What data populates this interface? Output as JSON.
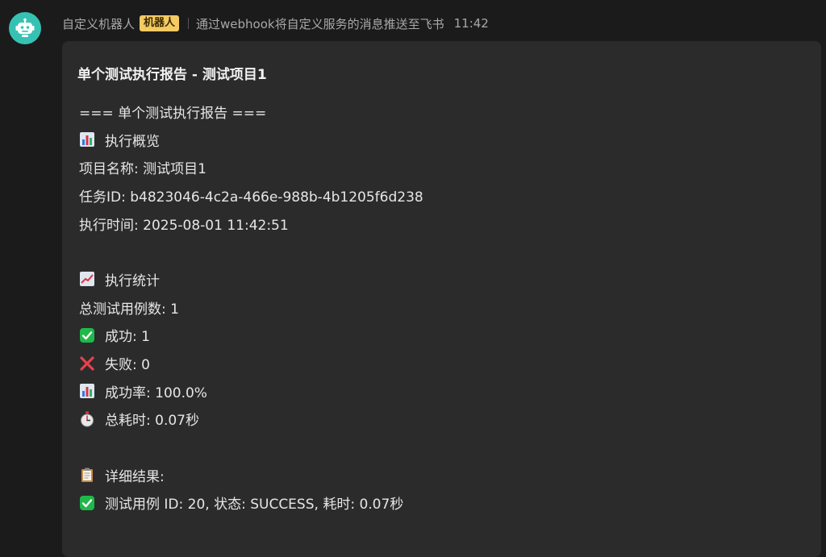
{
  "sender": {
    "name": "自定义机器人",
    "badge": "机器人",
    "description": "通过webhook将自定义服务的消息推送至飞书",
    "time": "11:42"
  },
  "card": {
    "title": "单个测试执行报告 - 测试项目1",
    "lines": {
      "header": "=== 单个测试执行报告 ===",
      "overview_heading": "执行概览",
      "project_name": "项目名称: 测试项目1",
      "task_id": "任务ID: b4823046-4c2a-466e-988b-4b1205f6d238",
      "exec_time": "执行时间: 2025-08-01 11:42:51",
      "stats_heading": "执行统计",
      "total_cases": "总测试用例数: 1",
      "success": "成功: 1",
      "failed": "失败: 0",
      "success_rate": "成功率: 100.0%",
      "duration": "总耗时: 0.07秒",
      "details_heading": "详细结果:",
      "case_result": "测试用例 ID: 20, 状态: SUCCESS, 耗时: 0.07秒"
    }
  },
  "icons": {
    "avatar": "robot-icon",
    "overview": "bar-chart-icon",
    "stats": "trend-chart-icon",
    "success": "check-mark-icon",
    "failed": "cross-mark-icon",
    "rate": "bar-chart-icon",
    "duration": "stopwatch-icon",
    "details": "clipboard-icon",
    "case": "check-mark-icon"
  },
  "colors": {
    "background": "#1b1b1b",
    "card": "#2b2b2b",
    "avatar": "#36c2b3",
    "badge": "#f3ca63",
    "check": "#1fb94b",
    "cross": "#e8414e"
  }
}
